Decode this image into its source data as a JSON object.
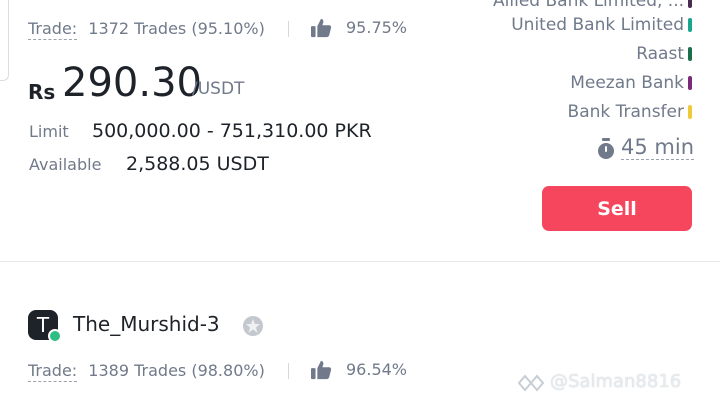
{
  "offer1": {
    "trade_label": "Trade:",
    "trades_text": "1372 Trades (95.10%)",
    "rating": "95.75%",
    "currency_symbol": "Rs",
    "price": "290.30",
    "price_unit": "/USDT",
    "limit_label": "Limit",
    "limit_value": "500,000.00 - 751,310.00 PKR",
    "available_label": "Available",
    "available_value": "2,588.05 USDT",
    "payment_methods": [
      {
        "name": "Allied Bank Limited, ...",
        "color": "#4a2b52"
      },
      {
        "name": "United Bank Limited",
        "color": "#1aa58d"
      },
      {
        "name": "Raast",
        "color": "#1b6e4a"
      },
      {
        "name": "Meezan Bank",
        "color": "#7b2a7a"
      },
      {
        "name": "Bank Transfer",
        "color": "#f0c93a"
      }
    ],
    "time_limit": "45 min",
    "sell_label": "Sell"
  },
  "offer2": {
    "avatar_letter": "T",
    "merchant_name": "The_Murshid-3",
    "trade_label": "Trade:",
    "trades_text": "1389 Trades (98.80%)",
    "rating": "96.54%"
  },
  "watermark": "@Salman8816"
}
